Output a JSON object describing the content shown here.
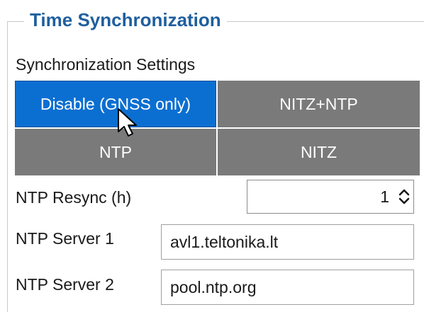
{
  "group": {
    "title": "Time Synchronization"
  },
  "sync": {
    "section_label": "Synchronization Settings",
    "modes": [
      {
        "label": "Disable (GNSS only)",
        "active": true
      },
      {
        "label": "NITZ+NTP",
        "active": false
      },
      {
        "label": "NTP",
        "active": false
      },
      {
        "label": "NITZ",
        "active": false
      }
    ]
  },
  "ntp_resync": {
    "label": "NTP Resync (h)",
    "value": "1"
  },
  "ntp_server_1": {
    "label": "NTP Server 1",
    "value": "avl1.teltonika.lt"
  },
  "ntp_server_2": {
    "label": "NTP Server 2",
    "value": "pool.ntp.org"
  },
  "colors": {
    "title": "#1f5f9e",
    "active_button": "#0b6fd1",
    "inactive_button": "#7a7a7a"
  },
  "icons": {
    "spinner": "up-down-chevron-icon",
    "cursor": "mouse-pointer-icon"
  }
}
